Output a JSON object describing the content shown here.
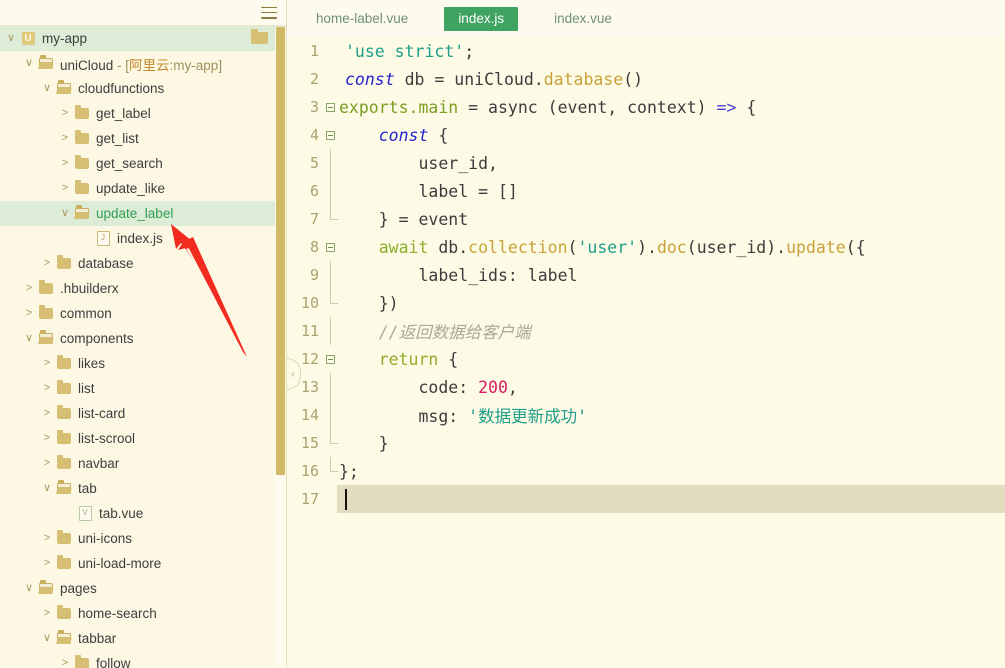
{
  "sidebar": {
    "menu_icon": "hamburger-icon",
    "scrollbar": "vertical-scrollbar",
    "tree": [
      {
        "depth": 0,
        "twisty": "∨",
        "icon": "project-badge",
        "label": "my-app",
        "state": "highlight",
        "trailing_icon": "folder-icon"
      },
      {
        "depth": 1,
        "twisty": "∨",
        "icon": "folder-open-icon",
        "label": "uniCloud",
        "suffix": " - [",
        "suffix_zh": "阿里云",
        "suffix_tail": ":my-app]",
        "state": "normal"
      },
      {
        "depth": 2,
        "twisty": "∨",
        "icon": "folder-open-icon",
        "label": "cloudfunctions",
        "state": "normal"
      },
      {
        "depth": 3,
        "twisty": ">",
        "icon": "folder-icon",
        "label": "get_label",
        "state": "normal"
      },
      {
        "depth": 3,
        "twisty": ">",
        "icon": "folder-icon",
        "label": "get_list",
        "state": "normal"
      },
      {
        "depth": 3,
        "twisty": ">",
        "icon": "folder-icon",
        "label": "get_search",
        "state": "normal"
      },
      {
        "depth": 3,
        "twisty": ">",
        "icon": "folder-icon",
        "label": "update_like",
        "state": "normal"
      },
      {
        "depth": 3,
        "twisty": "∨",
        "icon": "folder-open-icon",
        "label": "update_label",
        "state": "selected"
      },
      {
        "depth": 4,
        "twisty": "",
        "icon": "js-file-icon",
        "label": "index.js",
        "state": "normal"
      },
      {
        "depth": 2,
        "twisty": ">",
        "icon": "folder-icon",
        "label": "database",
        "state": "normal"
      },
      {
        "depth": 1,
        "twisty": ">",
        "icon": "folder-icon",
        "label": ".hbuilderx",
        "state": "normal"
      },
      {
        "depth": 1,
        "twisty": ">",
        "icon": "folder-icon",
        "label": "common",
        "state": "normal"
      },
      {
        "depth": 1,
        "twisty": "∨",
        "icon": "folder-open-icon",
        "label": "components",
        "state": "normal"
      },
      {
        "depth": 2,
        "twisty": ">",
        "icon": "folder-icon",
        "label": "likes",
        "state": "normal"
      },
      {
        "depth": 2,
        "twisty": ">",
        "icon": "folder-icon",
        "label": "list",
        "state": "normal"
      },
      {
        "depth": 2,
        "twisty": ">",
        "icon": "folder-icon",
        "label": "list-card",
        "state": "normal"
      },
      {
        "depth": 2,
        "twisty": ">",
        "icon": "folder-icon",
        "label": "list-scrool",
        "state": "normal"
      },
      {
        "depth": 2,
        "twisty": ">",
        "icon": "folder-icon",
        "label": "navbar",
        "state": "normal"
      },
      {
        "depth": 2,
        "twisty": "∨",
        "icon": "folder-open-icon",
        "label": "tab",
        "state": "normal"
      },
      {
        "depth": 3,
        "twisty": "",
        "icon": "vue-file-icon",
        "label": "tab.vue",
        "state": "normal"
      },
      {
        "depth": 2,
        "twisty": ">",
        "icon": "folder-icon",
        "label": "uni-icons",
        "state": "normal"
      },
      {
        "depth": 2,
        "twisty": ">",
        "icon": "folder-icon",
        "label": "uni-load-more",
        "state": "normal"
      },
      {
        "depth": 1,
        "twisty": "∨",
        "icon": "folder-open-icon",
        "label": "pages",
        "state": "normal"
      },
      {
        "depth": 2,
        "twisty": ">",
        "icon": "folder-icon",
        "label": "home-search",
        "state": "normal"
      },
      {
        "depth": 2,
        "twisty": "∨",
        "icon": "folder-open-icon",
        "label": "tabbar",
        "state": "normal"
      },
      {
        "depth": 3,
        "twisty": ">",
        "icon": "folder-icon",
        "label": "follow",
        "state": "normal"
      }
    ]
  },
  "editor": {
    "tabs": [
      {
        "label": "home-label.vue",
        "active": false
      },
      {
        "label": "index.js",
        "active": true
      },
      {
        "label": "index.vue",
        "active": false
      }
    ],
    "active_tab": "index.js",
    "cursor_line": 17,
    "total_lines": 17,
    "collapse_handle_icon": "chevron-left-icon",
    "lines": [
      {
        "n": "1",
        "fold": "none",
        "indent": 0
      },
      {
        "n": "2",
        "fold": "none",
        "indent": 0
      },
      {
        "n": "3",
        "fold": "minus",
        "indent": 0
      },
      {
        "n": "4",
        "fold": "minus",
        "indent": 1
      },
      {
        "n": "5",
        "fold": "bar",
        "indent": 2
      },
      {
        "n": "6",
        "fold": "bar",
        "indent": 2
      },
      {
        "n": "7",
        "fold": "end",
        "indent": 1
      },
      {
        "n": "8",
        "fold": "minus",
        "indent": 1
      },
      {
        "n": "9",
        "fold": "bar",
        "indent": 2
      },
      {
        "n": "10",
        "fold": "end",
        "indent": 1
      },
      {
        "n": "11",
        "fold": "bar",
        "indent": 1
      },
      {
        "n": "12",
        "fold": "minus",
        "indent": 1
      },
      {
        "n": "13",
        "fold": "bar",
        "indent": 2
      },
      {
        "n": "14",
        "fold": "bar",
        "indent": 2
      },
      {
        "n": "15",
        "fold": "end",
        "indent": 1
      },
      {
        "n": "16",
        "fold": "end",
        "indent": 0
      },
      {
        "n": "17",
        "fold": "none",
        "indent": 0
      }
    ],
    "code": {
      "l1": "'use strict';",
      "l2": "const db = uniCloud.database()",
      "l3": "exports.main = async (event, context) => {",
      "l4": "    const {",
      "l5": "        user_id,",
      "l6": "        label = []",
      "l7": "    } = event",
      "l8": "    await db.collection('user').doc(user_id).update({",
      "l9": "        label_ids: label",
      "l10": "    })",
      "l11": "    //返回数据给客户端",
      "l12": "    return {",
      "l13": "        code: 200,",
      "l14": "        msg: '数据更新成功'",
      "l15": "    }",
      "l16": "};",
      "l17": ""
    },
    "tokens": {
      "str_use_strict": "'use strict'",
      "kw_const": "const",
      "id_db": "db",
      "id_uniCloud": "uniCloud",
      "fn_database": "database",
      "exp_exports_main": "exports.main",
      "kw_async": "async",
      "arg_event": "event",
      "arg_context": "context",
      "op_arrow": "=>",
      "id_user_id": "user_id",
      "id_label": "label",
      "kw_await": "await",
      "fn_collection": "collection",
      "str_user": "'user'",
      "fn_doc": "doc",
      "fn_update": "update",
      "prop_label_ids": "label_ids",
      "kw_return": "return",
      "prop_code": "code",
      "num_200": "200",
      "prop_msg": "msg",
      "str_success": "'数据更新成功'",
      "comment_cn": "//返回数据给客户端"
    }
  },
  "annotation": {
    "arrow": "red-arrow-pointing-to-update_label",
    "color": "#f22b21"
  },
  "colors": {
    "bg": "#fdfae6",
    "sidebar_bg": "#fdf8e3",
    "selection": "#dcecd7",
    "active_tab": "#3fa361",
    "active_line": "#e2dcc0",
    "scrollbar": "#d2b964",
    "accent_red": "#f22b21"
  }
}
